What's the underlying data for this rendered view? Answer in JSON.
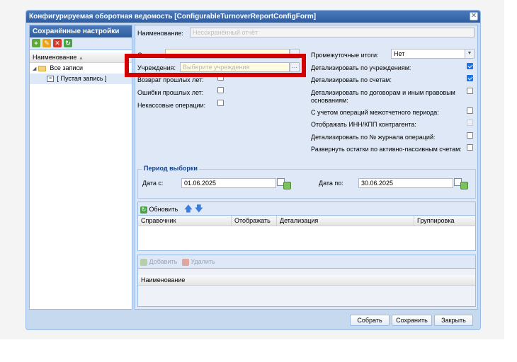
{
  "window": {
    "title": "Конфигурируемая оборотная ведомость [ConfigurableTurnoverReportConfigForm]",
    "close_glyph": "✕"
  },
  "left_panel": {
    "title": "Сохранённые настройки",
    "column_header": "Наименование",
    "tree": {
      "root": "Все записи",
      "child": "[ Пустая запись ]"
    }
  },
  "form": {
    "name_label": "Наименование:",
    "name_placeholder": "Несохранённый отчёт",
    "accounts_label": "Счета:",
    "institutions_label": "Учреждения:",
    "institutions_placeholder": "Выберите учреждения",
    "prev_years_label": "Возврат прошлых лет:",
    "prev_errors_label": "Ошибки прошлых лет:",
    "noncash_label": "Некассовые операции:",
    "subtotals_label": "Промежуточные итоги:",
    "subtotals_value": "Нет",
    "options": [
      {
        "label": "Детализировать по учреждениям:",
        "checked": true,
        "disabled": false
      },
      {
        "label": "Детализировать по счетам:",
        "checked": true,
        "disabled": false
      },
      {
        "label": "Детализировать по договорам и иным правовым основаниям:",
        "checked": false,
        "disabled": false
      },
      {
        "label": "С учетом операций межотчетного периода:",
        "checked": false,
        "disabled": false
      },
      {
        "label": "Отображать ИНН/КПП контрагента:",
        "checked": false,
        "disabled": true
      },
      {
        "label": "Детализировать по № журнала операций:",
        "checked": false,
        "disabled": false
      },
      {
        "label": "Развернуть остатки по активно-пассивным счетам:",
        "checked": false,
        "disabled": false
      }
    ]
  },
  "period": {
    "legend": "Период выборки",
    "from_label": "Дата с:",
    "from_value": "01.06.2025",
    "to_label": "Дата по:",
    "to_value": "30.06.2025"
  },
  "grid1": {
    "refresh_label": "Обновить",
    "columns": [
      "Справочник",
      "Отображать",
      "Детализация",
      "Группировка"
    ]
  },
  "grid2": {
    "add_label": "Добавить",
    "delete_label": "Удалить",
    "columns": [
      "Наименование"
    ]
  },
  "footer": {
    "select": "Собрать",
    "save": "Сохранить",
    "close": "Закрыть"
  },
  "colors": {
    "highlight": "#d20000",
    "header": "#2f5c9d"
  }
}
